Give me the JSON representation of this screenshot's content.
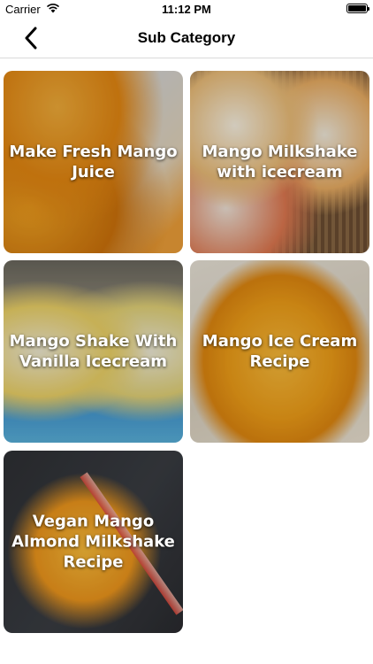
{
  "status_bar": {
    "carrier": "Carrier",
    "time": "11:12 PM",
    "icons": [
      "wifi-icon",
      "battery-icon"
    ]
  },
  "nav_bar": {
    "title": "Sub Category",
    "back_icon": "chevron-left-icon"
  },
  "categories": [
    {
      "label": "Make Fresh Mango Juice"
    },
    {
      "label": "Mango Milkshake with icecream"
    },
    {
      "label": "Mango Shake With Vanilla Icecream"
    },
    {
      "label": "Mango Ice Cream Recipe"
    },
    {
      "label": "Vegan Mango Almond Milkshake Recipe"
    }
  ]
}
